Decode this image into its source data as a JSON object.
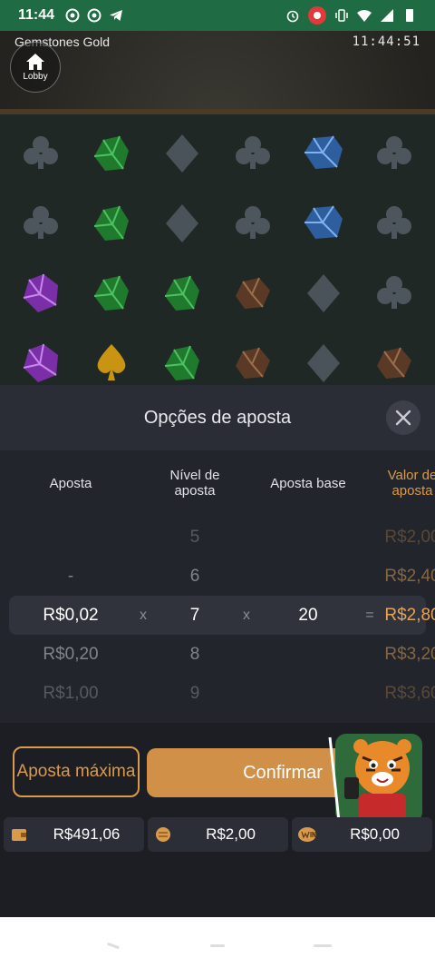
{
  "status_bar": {
    "time": "11:44",
    "left_icons": [
      "target-icon",
      "target-icon",
      "telegram-icon"
    ],
    "right_icons": [
      "alarm-icon",
      "record-icon",
      "vibrate-icon",
      "wifi-icon",
      "signal-icon",
      "battery-icon"
    ]
  },
  "game": {
    "title": "Gemstones Gold",
    "clock": "11:44:51",
    "lobby_label": "Lobby",
    "grid": [
      [
        "club",
        "green",
        "diamond",
        "club",
        "blue",
        "club"
      ],
      [
        "club",
        "green",
        "diamond",
        "club",
        "blue",
        "club"
      ],
      [
        "purple",
        "green",
        "green",
        "brown",
        "diamond",
        "club"
      ],
      [
        "purple",
        "spade",
        "green",
        "brown",
        "diamond",
        "brown"
      ]
    ]
  },
  "bet_panel": {
    "title": "Opções de aposta",
    "headers": {
      "aposta": "Aposta",
      "nivel": "Nível de aposta",
      "base": "Aposta base",
      "valor": "Valor de aposta"
    },
    "rows": [
      {
        "aposta": "",
        "nivel": "5",
        "base": "",
        "valor": "R$2,00"
      },
      {
        "aposta": "-",
        "nivel": "6",
        "base": "",
        "valor": "R$2,40"
      },
      {
        "aposta": "R$0,02",
        "nivel": "7",
        "base": "20",
        "valor": "R$2,80"
      },
      {
        "aposta": "R$0,20",
        "nivel": "8",
        "base": "",
        "valor": "R$3,20"
      },
      {
        "aposta": "R$1,00",
        "nivel": "9",
        "base": "",
        "valor": "R$3,60"
      }
    ],
    "operators": {
      "times1": "x",
      "times2": "x",
      "equals": "="
    },
    "max_bet_label": "Aposta máxima",
    "confirm_label": "Confirmar"
  },
  "stats": {
    "balance": "R$491,06",
    "bet": "R$2,00",
    "win": "R$0,00"
  },
  "colors": {
    "accent": "#d99a4c",
    "status_bar": "#1f6b44",
    "panel": "#23252d"
  }
}
